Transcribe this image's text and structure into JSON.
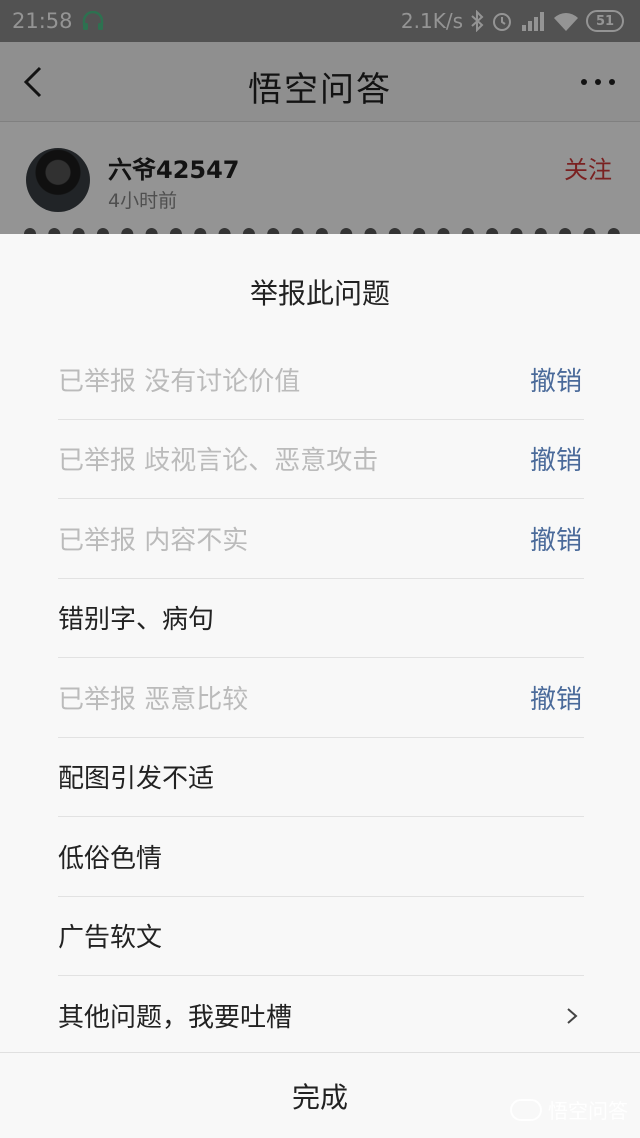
{
  "status_bar": {
    "time": "21:58",
    "net_speed": "2.1K/s",
    "battery": "51",
    "icons": [
      "headset-icon",
      "bluetooth-icon",
      "alarm-icon",
      "signal-icon",
      "wifi-icon",
      "battery-icon"
    ]
  },
  "header": {
    "title": "悟空问答",
    "back_icon": "back-arrow-icon",
    "more_icon": "more-icon"
  },
  "post": {
    "author": "六爷42547",
    "time": "4小时前",
    "follow_label": "关注"
  },
  "sheet": {
    "title": "举报此问题",
    "items": [
      {
        "text": "已举报 没有讨论价值",
        "reported": true,
        "action": "撤销"
      },
      {
        "text": "已举报 歧视言论、恶意攻击",
        "reported": true,
        "action": "撤销"
      },
      {
        "text": "已举报 内容不实",
        "reported": true,
        "action": "撤销"
      },
      {
        "text": "错别字、病句",
        "reported": false
      },
      {
        "text": "已举报 恶意比较",
        "reported": true,
        "action": "撤销"
      },
      {
        "text": "配图引发不适",
        "reported": false
      },
      {
        "text": "低俗色情",
        "reported": false
      },
      {
        "text": "广告软文",
        "reported": false
      },
      {
        "text": "其他问题，我要吐槽",
        "reported": false,
        "has_chevron": true
      }
    ],
    "done_label": "完成"
  },
  "watermark": {
    "text": "悟空问答"
  },
  "colors": {
    "revoke": "#4a6a9a",
    "follow": "#d33a3a",
    "reported_text": "#bbbbbb"
  }
}
